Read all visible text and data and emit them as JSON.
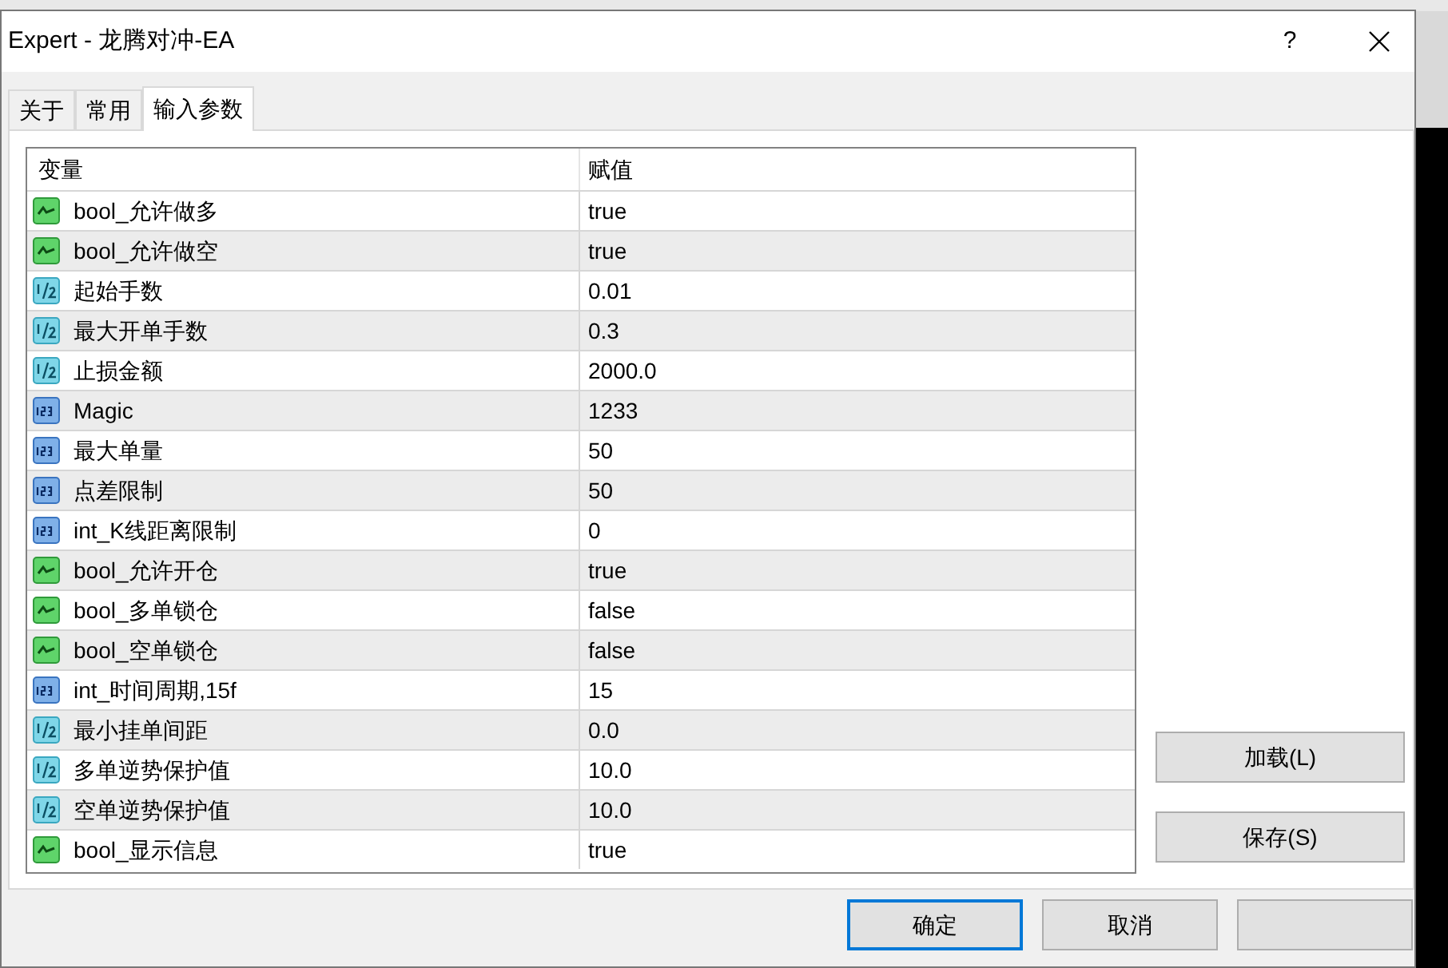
{
  "window": {
    "title": "Expert - 龙腾对冲-EA",
    "help": "?"
  },
  "tabs": [
    {
      "label": "关于",
      "selected": false
    },
    {
      "label": "常用",
      "selected": false
    },
    {
      "label": "输入参数",
      "selected": true
    }
  ],
  "table": {
    "columns": [
      "变量",
      "赋值"
    ],
    "rows": [
      {
        "kind": "bool",
        "name": "bool_允许做多",
        "value": "true"
      },
      {
        "kind": "bool",
        "name": "bool_允许做空",
        "value": "true"
      },
      {
        "kind": "double",
        "name": "起始手数",
        "value": "0.01"
      },
      {
        "kind": "double",
        "name": "最大开单手数",
        "value": "0.3"
      },
      {
        "kind": "double",
        "name": "止损金额",
        "value": "2000.0"
      },
      {
        "kind": "int",
        "name": "Magic",
        "value": "1233"
      },
      {
        "kind": "int",
        "name": "最大单量",
        "value": "50"
      },
      {
        "kind": "int",
        "name": "点差限制",
        "value": "50"
      },
      {
        "kind": "int",
        "name": "int_K线距离限制",
        "value": "0"
      },
      {
        "kind": "bool",
        "name": "bool_允许开仓",
        "value": "true"
      },
      {
        "kind": "bool",
        "name": "bool_多单锁仓",
        "value": "false"
      },
      {
        "kind": "bool",
        "name": "bool_空单锁仓",
        "value": "false"
      },
      {
        "kind": "int",
        "name": "int_时间周期,15f",
        "value": "15"
      },
      {
        "kind": "double",
        "name": "最小挂单间距",
        "value": "0.0"
      },
      {
        "kind": "double",
        "name": "多单逆势保护值",
        "value": "10.0"
      },
      {
        "kind": "double",
        "name": "空单逆势保护值",
        "value": "10.0"
      },
      {
        "kind": "bool",
        "name": "bool_显示信息",
        "value": "true"
      }
    ]
  },
  "side_buttons": [
    "加载(L)",
    "保存(S)"
  ],
  "footer_buttons": [
    {
      "label": "确定",
      "default": true
    },
    {
      "label": "取消",
      "default": false
    },
    {
      "default": false
    }
  ]
}
